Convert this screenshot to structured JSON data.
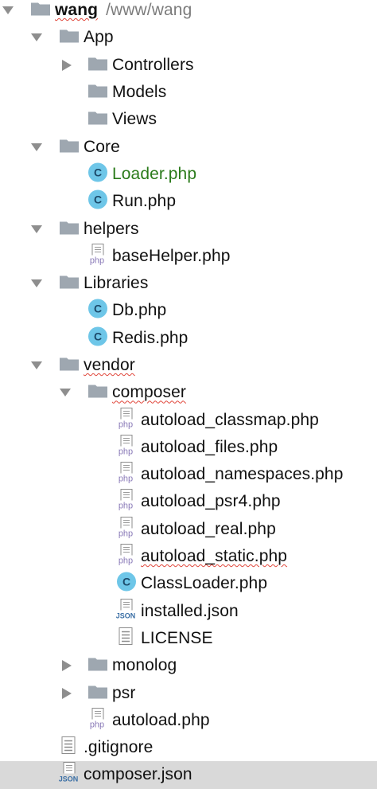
{
  "tree": {
    "root": {
      "name": "wang",
      "path": "/www/wang"
    },
    "app": {
      "name": "App"
    },
    "controllers": {
      "name": "Controllers"
    },
    "models": {
      "name": "Models"
    },
    "views": {
      "name": "Views"
    },
    "core": {
      "name": "Core"
    },
    "loader": {
      "name": "Loader.php"
    },
    "run": {
      "name": "Run.php"
    },
    "helpers": {
      "name": "helpers"
    },
    "basehelper": {
      "name": "baseHelper.php"
    },
    "libraries": {
      "name": "Libraries"
    },
    "db": {
      "name": "Db.php"
    },
    "redis": {
      "name": "Redis.php"
    },
    "vendor": {
      "name": "vendor"
    },
    "composer_dir": {
      "name": "composer"
    },
    "autoload_classmap": {
      "name": "autoload_classmap.php"
    },
    "autoload_files": {
      "name": "autoload_files.php"
    },
    "autoload_namespaces": {
      "name": "autoload_namespaces.php"
    },
    "autoload_psr4": {
      "name": "autoload_psr4.php"
    },
    "autoload_real": {
      "name": "autoload_real.php"
    },
    "autoload_static": {
      "name": "autoload_static.php"
    },
    "classloader": {
      "name": "ClassLoader.php"
    },
    "installed_json": {
      "name": "installed.json"
    },
    "license": {
      "name": "LICENSE"
    },
    "monolog": {
      "name": "monolog"
    },
    "psr": {
      "name": "psr"
    },
    "autoload": {
      "name": "autoload.php"
    },
    "gitignore": {
      "name": ".gitignore"
    },
    "composer_json": {
      "name": "composer.json"
    }
  },
  "icon_labels": {
    "php": "php",
    "json": "JSON",
    "class": "C"
  },
  "colors": {
    "folder": "#9ea7b0",
    "class_badge": "#6ec6e8",
    "class_badge_text": "#1c4a6a",
    "php_badge": "#8a7ab8",
    "json_badge": "#3b6fa5",
    "modified_file": "#2a7a1a",
    "selection": "#d9d9d9",
    "squiggle": "#e0453a"
  }
}
